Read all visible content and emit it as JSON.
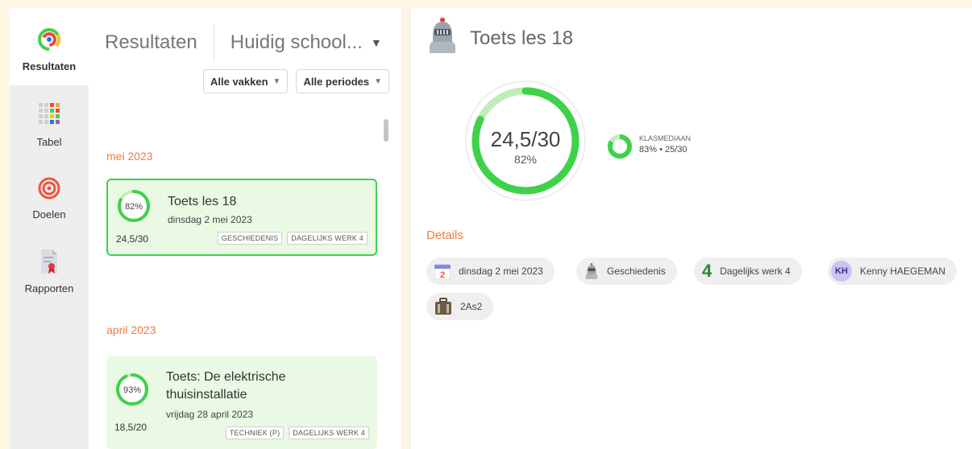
{
  "sidebar": {
    "items": [
      {
        "label": "Resultaten",
        "icon": "results-icon",
        "active": true
      },
      {
        "label": "Tabel",
        "icon": "table-icon",
        "active": false
      },
      {
        "label": "Doelen",
        "icon": "target-icon",
        "active": false
      },
      {
        "label": "Rapporten",
        "icon": "report-icon",
        "active": false
      }
    ]
  },
  "list": {
    "title": "Resultaten",
    "school_selector": "Huidig school...",
    "filters": [
      "Alle vakken",
      "Alle periodes"
    ],
    "groups": [
      {
        "month": "mei 2023",
        "cards": [
          {
            "percent": "82%",
            "fraction": 0.82,
            "title": "Toets les 18",
            "date": "dinsdag 2 mei 2023",
            "score": "24,5/30",
            "tags": [
              "GESCHIEDENIS",
              "DAGELIJKS WERK 4"
            ],
            "selected": true
          }
        ]
      },
      {
        "month": "april 2023",
        "cards": [
          {
            "percent": "93%",
            "fraction": 0.93,
            "title": "Toets: De elektrische thuisinstallatie",
            "date": "vrijdag 28 april 2023",
            "score": "18,5/20",
            "tags": [
              "TECHNIEK (P)",
              "DAGELIJKS WERK 4"
            ],
            "selected": false
          }
        ]
      }
    ]
  },
  "detail": {
    "title": "Toets les 18",
    "icon": "knight-helmet-icon",
    "score": "24,5/30",
    "percent": "82%",
    "fraction": 0.82,
    "median": {
      "label": "KLASMEDIAAN",
      "value": "83% • 25/30",
      "fraction": 0.83
    },
    "details_heading": "Details",
    "chips": {
      "date": {
        "label": "dinsdag 2 mei 2023",
        "icon_text": "2"
      },
      "subject": {
        "label": "Geschiedenis"
      },
      "period": {
        "label": "Dagelijks werk 4",
        "number": "4"
      },
      "teacher": {
        "label": "Kenny HAEGEMAN",
        "initials": "KH"
      },
      "class": {
        "label": "2As2"
      }
    }
  },
  "colors": {
    "accent_orange": "#f07a3c",
    "ring_green": "#3fd14a",
    "card_green": "#e9f9e4"
  }
}
